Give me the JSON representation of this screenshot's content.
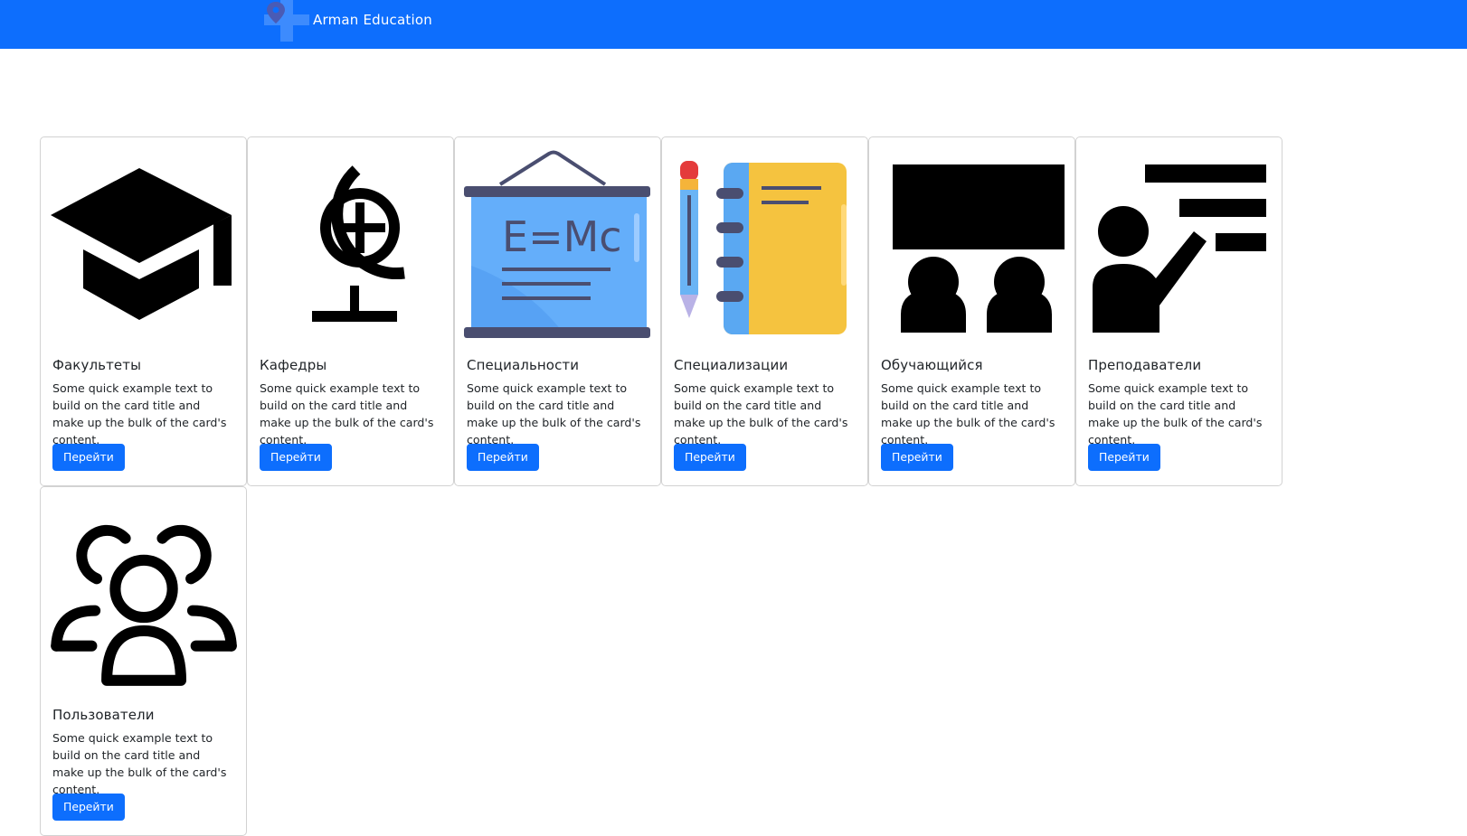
{
  "navbar": {
    "brand": "Arman Education",
    "logo_icon": "pin-plus-logo-icon"
  },
  "colors": {
    "primary": "#0d6efd",
    "card_border": "#d6d6d6",
    "text": "#212529"
  },
  "cards": [
    {
      "title": "Факультеты",
      "text": "Some quick example text to build on the card title and make up the bulk of the card's content.",
      "button": "Перейти",
      "icon": "graduation-cap-icon"
    },
    {
      "title": "Кафедры",
      "text": "Some quick example text to build on the card title and make up the bulk of the card's content.",
      "button": "Перейти",
      "icon": "globe-icon"
    },
    {
      "title": "Специальности",
      "text": "Some quick example text to build on the card title and make up the bulk of the card's content.",
      "button": "Перейти",
      "icon": "blackboard-icon"
    },
    {
      "title": "Специализации",
      "text": "Some quick example text to build on the card title and make up the bulk of the card's content.",
      "button": "Перейти",
      "icon": "notebook-pencil-icon"
    },
    {
      "title": "Обучающийся",
      "text": "Some quick example text to build on the card title and make up the bulk of the card's content.",
      "button": "Перейти",
      "icon": "students-icon"
    },
    {
      "title": "Преподаватели",
      "text": "Some quick example text to build on the card title and make up the bulk of the card's content.",
      "button": "Перейти",
      "icon": "teacher-icon"
    },
    {
      "title": "Пользователи",
      "text": "Some quick example text to build on the card title and make up the bulk of the card's content.",
      "button": "Перейти",
      "icon": "users-icon"
    }
  ]
}
